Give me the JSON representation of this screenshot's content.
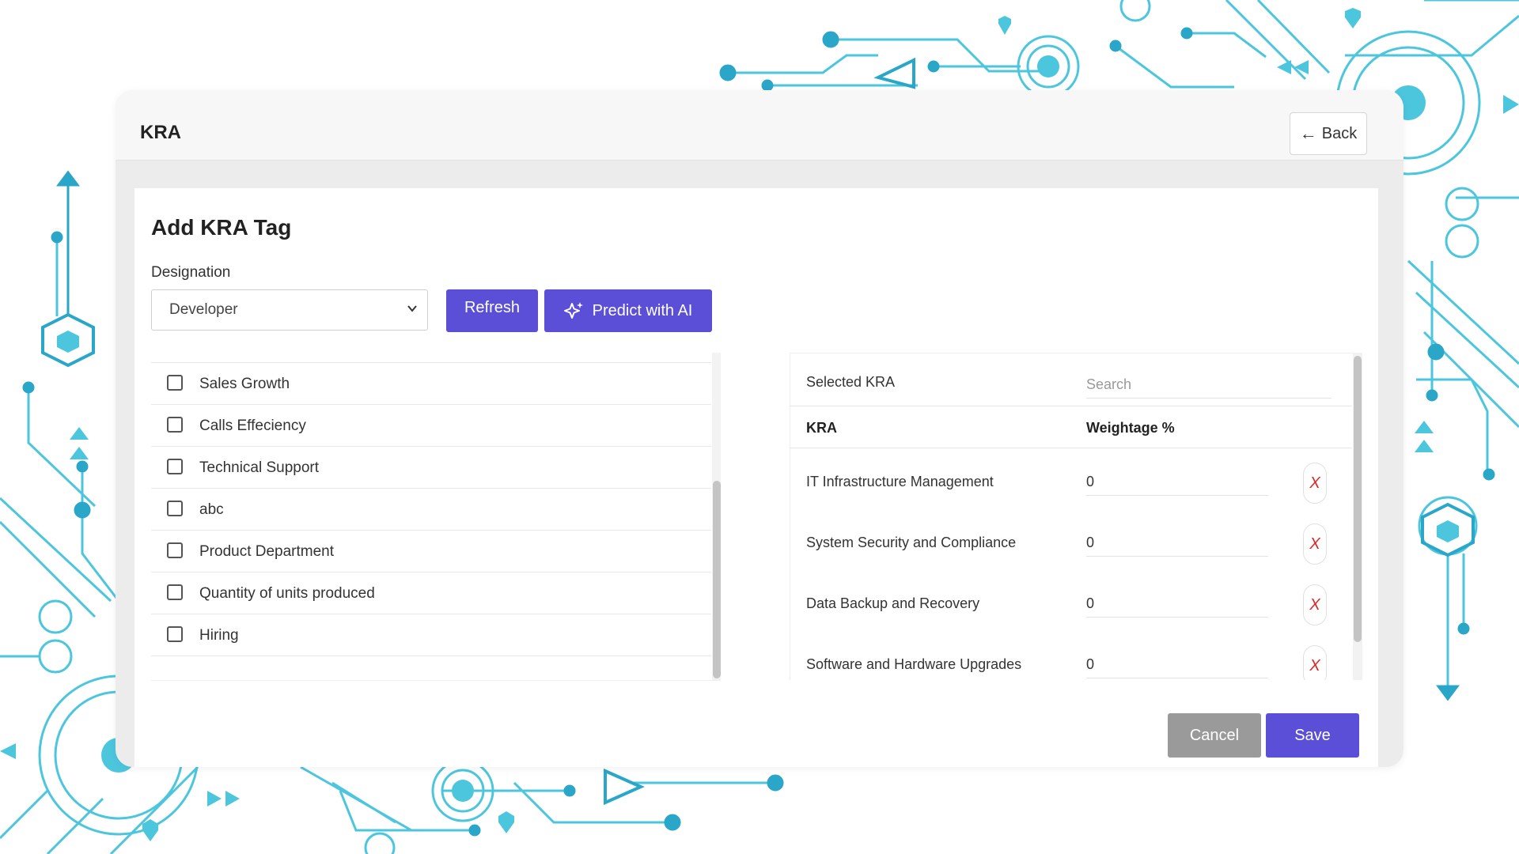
{
  "colors": {
    "accent": "#5a4fd6",
    "cancel": "#9a9a9a",
    "delete_x": "#e02424",
    "bg_circuit": "#4cc6dd",
    "bg_circuit_dark": "#2aa6c9"
  },
  "header": {
    "title": "KRA",
    "back_label": "Back",
    "back_icon": "arrow-left-icon"
  },
  "form": {
    "title": "Add KRA Tag",
    "designation_label": "Designation",
    "designation_value": "Developer",
    "refresh_label": "Refresh",
    "predict_label": "Predict with AI",
    "predict_icon": "sparkle-icon"
  },
  "available_kras": [
    {
      "label": "Sales Growth",
      "checked": false
    },
    {
      "label": "Calls Effeciency",
      "checked": false
    },
    {
      "label": "Technical Support",
      "checked": false
    },
    {
      "label": "abc",
      "checked": false
    },
    {
      "label": "Product Department",
      "checked": false
    },
    {
      "label": "Quantity of units produced",
      "checked": false
    },
    {
      "label": "Hiring",
      "checked": false
    }
  ],
  "selected": {
    "heading": "Selected KRA",
    "search_placeholder": "Search",
    "col_kra": "KRA",
    "col_weightage": "Weightage %",
    "delete_label": "X",
    "rows": [
      {
        "name": "IT Infrastructure Management",
        "weightage": "0"
      },
      {
        "name": "System Security and Compliance",
        "weightage": "0"
      },
      {
        "name": "Data Backup and Recovery",
        "weightage": "0"
      },
      {
        "name": "Software and Hardware Upgrades",
        "weightage": "0"
      }
    ]
  },
  "footer": {
    "cancel_label": "Cancel",
    "save_label": "Save"
  }
}
